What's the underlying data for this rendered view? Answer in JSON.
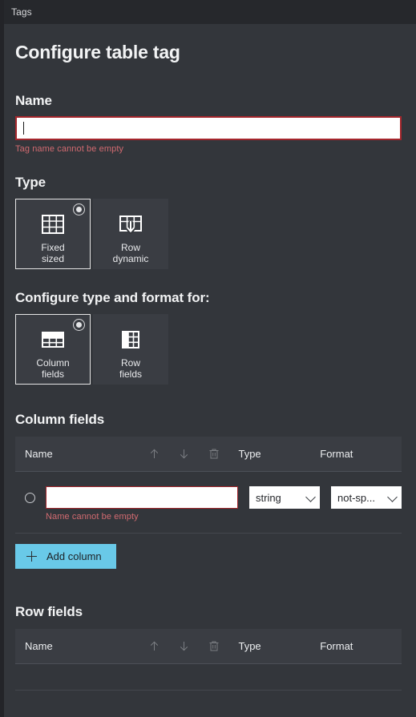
{
  "window": {
    "tab_label": "Tags"
  },
  "page": {
    "title": "Configure table tag"
  },
  "name_field": {
    "label": "Name",
    "value": "",
    "placeholder": "",
    "error": "Tag name cannot be empty"
  },
  "type_group": {
    "label": "Type",
    "options": [
      {
        "label": "Fixed\nsized",
        "icon": "table-fixed-icon",
        "selected": true
      },
      {
        "label": "Row\ndynamic",
        "icon": "table-row-dynamic-icon",
        "selected": false
      }
    ]
  },
  "format_group": {
    "label": "Configure type and format for:",
    "options": [
      {
        "label": "Column\nfields",
        "icon": "table-column-fields-icon",
        "selected": true
      },
      {
        "label": "Row\nfields",
        "icon": "table-row-fields-icon",
        "selected": false
      }
    ]
  },
  "column_fields": {
    "title": "Column fields",
    "headers": {
      "name": "Name",
      "move_up_icon": "arrow-up-icon",
      "move_down_icon": "arrow-down-icon",
      "delete_icon": "trash-icon",
      "type": "Type",
      "format": "Format"
    },
    "rows": [
      {
        "selected": false,
        "name": "",
        "name_error": "Name cannot be empty",
        "type": "string",
        "format": "not-sp..."
      }
    ],
    "add_button": "Add column"
  },
  "row_fields": {
    "title": "Row fields",
    "headers": {
      "name": "Name",
      "move_up_icon": "arrow-up-icon",
      "move_down_icon": "arrow-down-icon",
      "delete_icon": "trash-icon",
      "type": "Type",
      "format": "Format"
    }
  },
  "colors": {
    "background": "#33363b",
    "titlebar": "#26282c",
    "panel": "#3a3d43",
    "accent": "#69c9e8",
    "error": "#a4262c",
    "error_text": "#d16a70",
    "text": "#f2f3f4"
  }
}
